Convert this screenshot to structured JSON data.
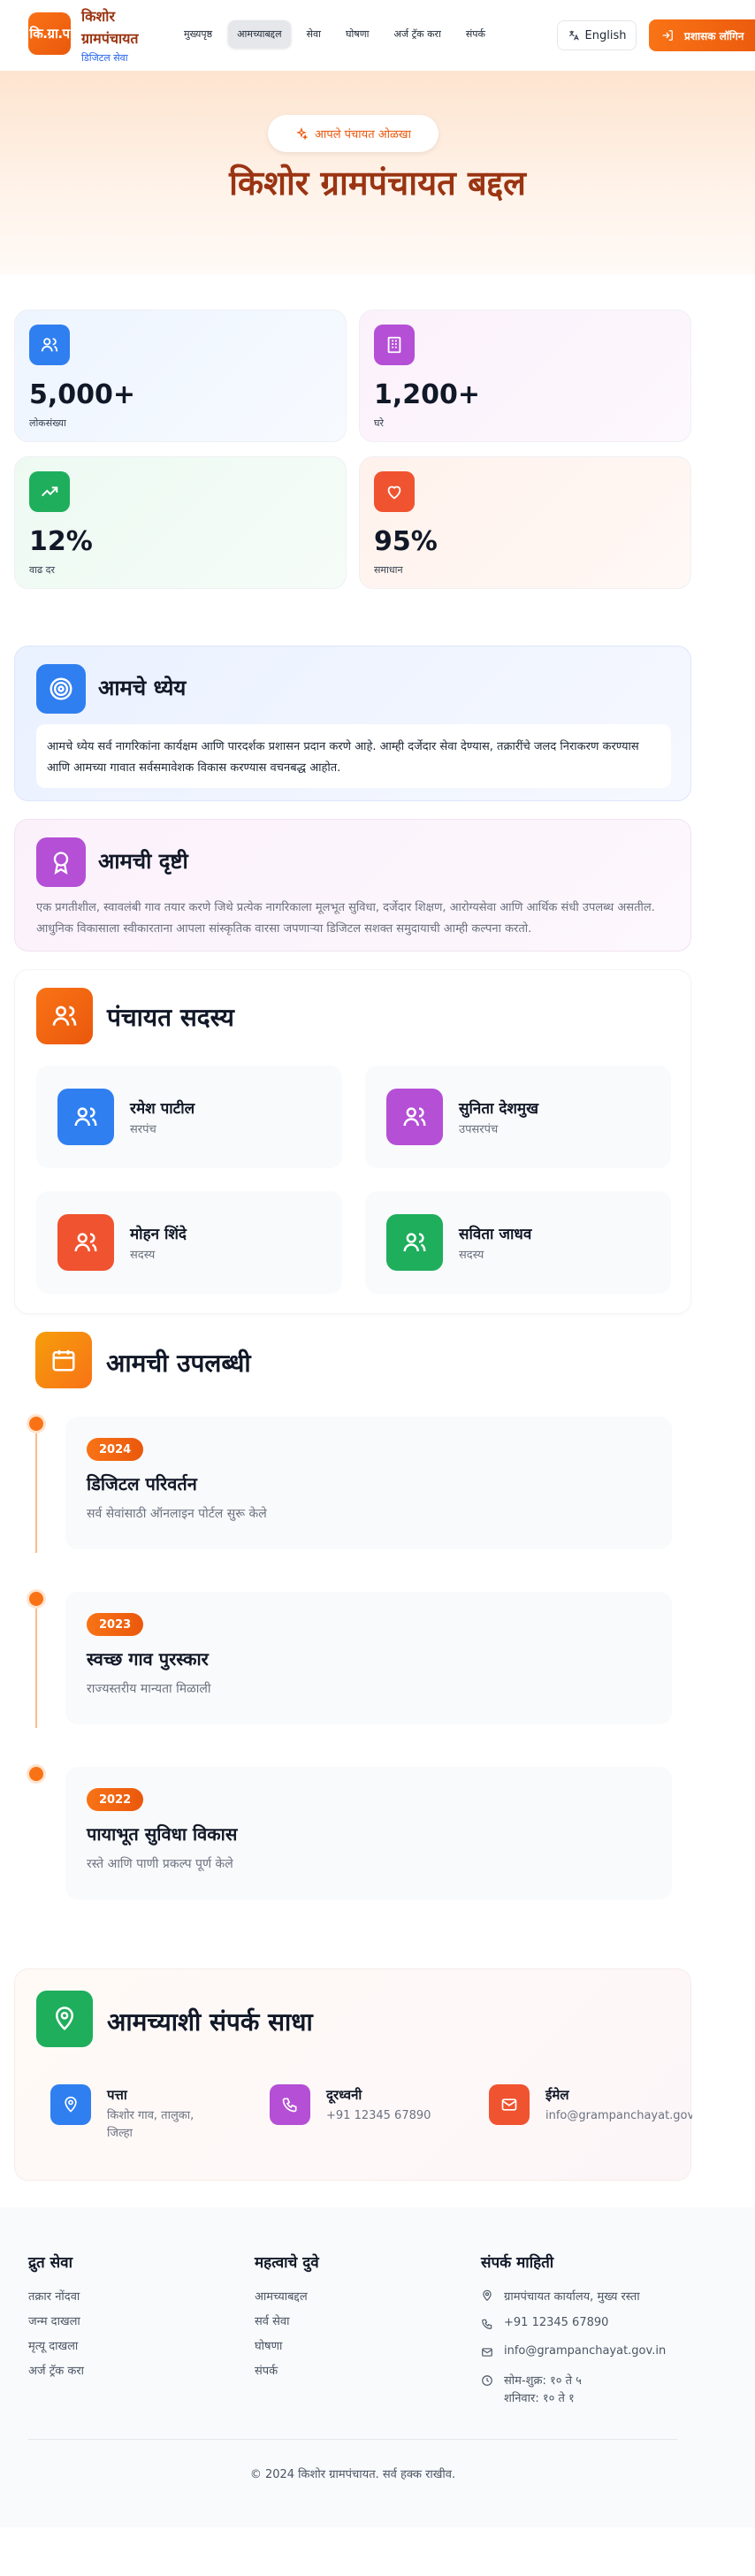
{
  "header": {
    "logo_text": "कि.ग्रा.प",
    "brand_title": "किशोर ग्रामपंचायत",
    "brand_subtitle": "डिजिटल सेवा",
    "nav": [
      "मुख्यपृष्ठ",
      "आमच्याबद्दल",
      "सेवा",
      "घोषणा",
      "अर्ज ट्रॅक करा",
      "संपर्क"
    ],
    "active_nav": "आमच्याबद्दल",
    "language_label": "English",
    "admin_login_label": "प्रशासक लॉगिन"
  },
  "hero": {
    "badge": "आपले पंचायत ओळखा",
    "title": "किशोर ग्रामपंचायत बद्दल"
  },
  "stats": [
    {
      "value": "5,000+",
      "label": "लोकसंख्या",
      "icon": "users-icon",
      "color": "#2f7ff0"
    },
    {
      "value": "1,200+",
      "label": "घरे",
      "icon": "building-icon",
      "color": "#b44fd6"
    },
    {
      "value": "12%",
      "label": "वाढ दर",
      "icon": "trending-up-icon",
      "color": "#1fae5c"
    },
    {
      "value": "95%",
      "label": "समाधान",
      "icon": "heart-icon",
      "color": "#f0532f"
    }
  ],
  "mission": {
    "title": "आमचे ध्येय",
    "text": "आमचे ध्येय सर्व नागरिकांना कार्यक्षम आणि पारदर्शक प्रशासन प्रदान करणे आहे. आम्ही दर्जेदार सेवा देण्यास, तक्रारींचे जलद निराकरण करण्यास आणि आमच्या गावात सर्वसमावेशक विकास करण्यास वचनबद्ध आहोत."
  },
  "vision": {
    "title": "आमची दृष्टी",
    "text": "एक प्रगतीशील, स्वावलंबी गाव तयार करणे जिथे प्रत्येक नागरिकाला मूलभूत सुविधा, दर्जेदार शिक्षण, आरोग्यसेवा आणि आर्थिक संधी उपलब्ध असतील. आधुनिक विकासाला स्वीकारताना आपला सांस्कृतिक वारसा जपणाऱ्या डिजिटल सशक्त समुदायाची आम्ही कल्पना करतो."
  },
  "members": {
    "title": "पंचायत सदस्य",
    "list": [
      {
        "name": "रमेश पाटील",
        "role": "सरपंच",
        "color": "#2f7ff0"
      },
      {
        "name": "सुनिता देशमुख",
        "role": "उपसरपंच",
        "color": "#b44fd6"
      },
      {
        "name": "मोहन शिंदे",
        "role": "सदस्य",
        "color": "#f0532f"
      },
      {
        "name": "सविता जाधव",
        "role": "सदस्य",
        "color": "#1fae5c"
      }
    ]
  },
  "achievements": {
    "title": "आमची उपलब्धी",
    "list": [
      {
        "year": "2024",
        "title": "डिजिटल परिवर्तन",
        "desc": "सर्व सेवांसाठी ऑनलाइन पोर्टल सुरू केले"
      },
      {
        "year": "2023",
        "title": "स्वच्छ गाव पुरस्कार",
        "desc": "राज्यस्तरीय मान्यता मिळाली"
      },
      {
        "year": "2022",
        "title": "पायाभूत सुविधा विकास",
        "desc": "रस्ते आणि पाणी प्रकल्प पूर्ण केले"
      }
    ]
  },
  "contact": {
    "title": "आमच्याशी संपर्क साधा",
    "items": [
      {
        "label": "पत्ता",
        "value": "किशोर गाव, तालुका, जिल्हा",
        "icon": "map-pin-icon",
        "color": "#2f7ff0"
      },
      {
        "label": "दूरध्वनी",
        "value": "+91 12345 67890",
        "icon": "phone-icon",
        "color": "#b44fd6"
      },
      {
        "label": "ईमेल",
        "value": "info@grampanchayat.gov.in",
        "icon": "mail-icon",
        "color": "#f0532f"
      }
    ]
  },
  "footer": {
    "quick_services_title": "द्रुत सेवा",
    "quick_services": [
      "तक्रार नोंदवा",
      "जन्म दाखला",
      "मृत्यू दाखला",
      "अर्ज ट्रॅक करा"
    ],
    "important_links_title": "महत्वाचे दुवे",
    "important_links": [
      "आमच्याबद्दल",
      "सर्व सेवा",
      "घोषणा",
      "संपर्क"
    ],
    "contact_info_title": "संपर्क माहिती",
    "address": "ग्रामपंचायत कार्यालय, मुख्य रस्ता",
    "phone": "+91 12345 67890",
    "email": "info@grampanchayat.gov.in",
    "hours_line1": "सोम-शुक्र: १० ते ५",
    "hours_line2": "शनिवार: १० ते १",
    "copyright": "© 2024 किशोर ग्रामपंचायत. सर्व हक्क राखीव."
  }
}
